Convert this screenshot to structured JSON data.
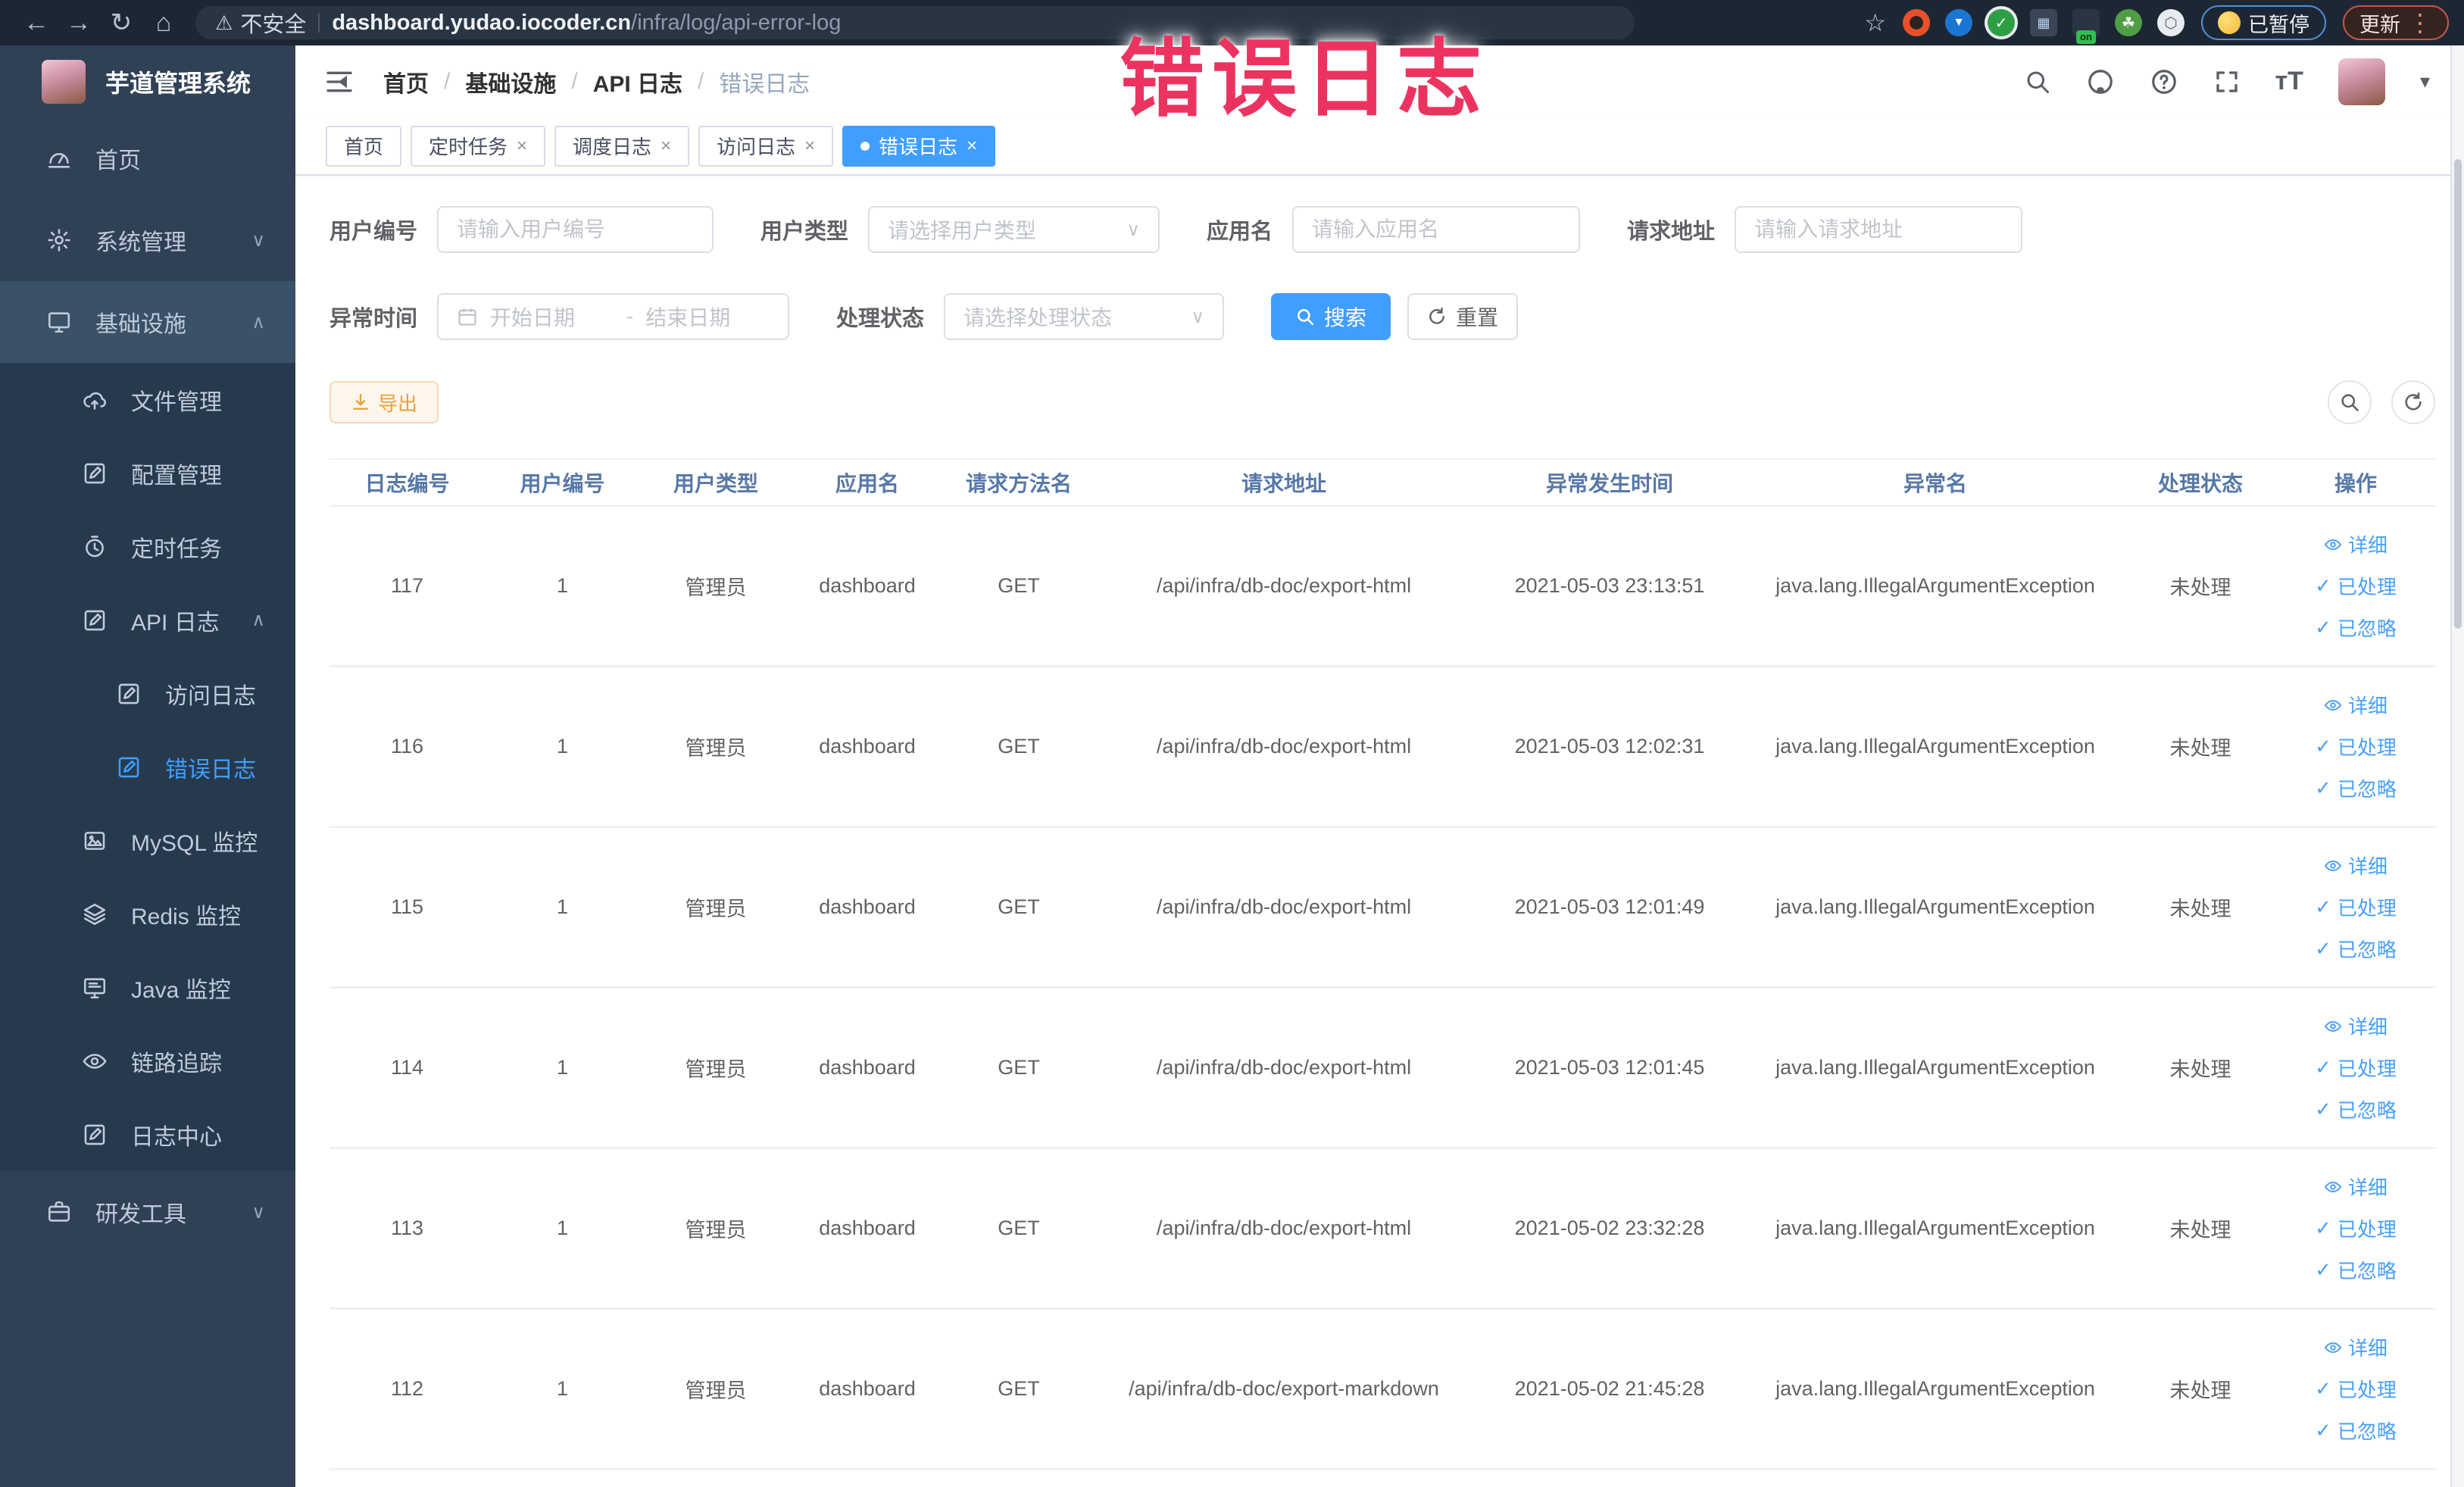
{
  "browser": {
    "security_label": "不安全",
    "url_host": "dashboard.yudao.iocoder.cn",
    "url_path": "/infra/log/api-error-log",
    "paused_label": "已暂停",
    "update_label": "更新",
    "extensions": [
      {
        "icon": "orange-ring-extension-icon",
        "bg": "#e8502a"
      },
      {
        "icon": "blue-shield-extension-icon",
        "bg": "#1976d2"
      },
      {
        "icon": "green-check-extension-icon",
        "bg": "#2e9e44"
      },
      {
        "icon": "grid-extension-icon",
        "bg": "#5c6b7a"
      },
      {
        "icon": "switch-on-extension-icon",
        "bg": "#2b3442",
        "badge": "on"
      },
      {
        "icon": "leaf-extension-icon",
        "bg": "#4f9e43"
      },
      {
        "icon": "puzzle-extension-icon",
        "bg": "#e8ecf1"
      }
    ]
  },
  "annotation": {
    "text": "错误日志",
    "color": "#ec3360"
  },
  "app": {
    "title": "芋道管理系统",
    "breadcrumb": [
      "首页",
      "基础设施",
      "API 日志",
      "错误日志"
    ],
    "tabs": [
      {
        "label": "首页",
        "closable": false,
        "active": false
      },
      {
        "label": "定时任务",
        "closable": true,
        "active": false
      },
      {
        "label": "调度日志",
        "closable": true,
        "active": false
      },
      {
        "label": "访问日志",
        "closable": true,
        "active": false
      },
      {
        "label": "错误日志",
        "closable": true,
        "active": true
      }
    ]
  },
  "sidebar": {
    "items": [
      {
        "label": "首页",
        "icon": "dashboard-icon",
        "level": 1
      },
      {
        "label": "系统管理",
        "icon": "gear-icon",
        "level": 1,
        "chevron": "down"
      },
      {
        "label": "基础设施",
        "icon": "monitor-icon",
        "level": 1,
        "chevron": "up",
        "highlight": true
      },
      {
        "label": "文件管理",
        "icon": "upload-icon",
        "level": 2,
        "submenu": true
      },
      {
        "label": "配置管理",
        "icon": "edit-square-icon",
        "level": 2,
        "submenu": true
      },
      {
        "label": "定时任务",
        "icon": "timer-icon",
        "level": 2,
        "submenu": true
      },
      {
        "label": "API 日志",
        "icon": "edit-square-icon",
        "level": 2,
        "submenu": true,
        "chevron": "up"
      },
      {
        "label": "访问日志",
        "icon": "edit-square-icon",
        "level": 3,
        "submenu": true
      },
      {
        "label": "错误日志",
        "icon": "edit-square-icon",
        "level": 3,
        "submenu": true,
        "active": true
      },
      {
        "label": "MySQL 监控",
        "icon": "mysql-picture-icon",
        "level": 2,
        "submenu": true
      },
      {
        "label": "Redis 监控",
        "icon": "layers-icon",
        "level": 2,
        "submenu": true
      },
      {
        "label": "Java 监控",
        "icon": "java-monitor-icon",
        "level": 2,
        "submenu": true
      },
      {
        "label": "链路追踪",
        "icon": "eye-icon",
        "level": 2,
        "submenu": true
      },
      {
        "label": "日志中心",
        "icon": "edit-square-icon",
        "level": 2,
        "submenu": true
      },
      {
        "label": "研发工具",
        "icon": "briefcase-icon",
        "level": 1,
        "chevron": "down"
      }
    ]
  },
  "filters": {
    "fields_row1": [
      {
        "label": "用户编号",
        "placeholder": "请输入用户编号",
        "type": "input"
      },
      {
        "label": "用户类型",
        "placeholder": "请选择用户类型",
        "type": "select"
      },
      {
        "label": "应用名",
        "placeholder": "请输入应用名",
        "type": "input"
      },
      {
        "label": "请求地址",
        "placeholder": "请输入请求地址",
        "type": "input"
      }
    ],
    "time_label": "异常时间",
    "date_start_placeholder": "开始日期",
    "date_separator": "-",
    "date_end_placeholder": "结束日期",
    "status_label": "处理状态",
    "status_placeholder": "请选择处理状态",
    "search_label": "搜索",
    "reset_label": "重置"
  },
  "toolbar": {
    "export_label": "导出"
  },
  "table": {
    "columns": [
      "日志编号",
      "用户编号",
      "用户类型",
      "应用名",
      "请求方法名",
      "请求地址",
      "异常发生时间",
      "异常名",
      "处理状态",
      "操作"
    ],
    "rows": [
      {
        "id": "117",
        "user_id": "1",
        "user_type": "管理员",
        "app_name": "dashboard",
        "method": "GET",
        "url": "/api/infra/db-doc/export-html",
        "time": "2021-05-03 23:13:51",
        "exception": "java.lang.IllegalArgumentException",
        "status": "未处理"
      },
      {
        "id": "116",
        "user_id": "1",
        "user_type": "管理员",
        "app_name": "dashboard",
        "method": "GET",
        "url": "/api/infra/db-doc/export-html",
        "time": "2021-05-03 12:02:31",
        "exception": "java.lang.IllegalArgumentException",
        "status": "未处理"
      },
      {
        "id": "115",
        "user_id": "1",
        "user_type": "管理员",
        "app_name": "dashboard",
        "method": "GET",
        "url": "/api/infra/db-doc/export-html",
        "time": "2021-05-03 12:01:49",
        "exception": "java.lang.IllegalArgumentException",
        "status": "未处理"
      },
      {
        "id": "114",
        "user_id": "1",
        "user_type": "管理员",
        "app_name": "dashboard",
        "method": "GET",
        "url": "/api/infra/db-doc/export-html",
        "time": "2021-05-03 12:01:45",
        "exception": "java.lang.IllegalArgumentException",
        "status": "未处理"
      },
      {
        "id": "113",
        "user_id": "1",
        "user_type": "管理员",
        "app_name": "dashboard",
        "method": "GET",
        "url": "/api/infra/db-doc/export-html",
        "time": "2021-05-02 23:32:28",
        "exception": "java.lang.IllegalArgumentException",
        "status": "未处理"
      },
      {
        "id": "112",
        "user_id": "1",
        "user_type": "管理员",
        "app_name": "dashboard",
        "method": "GET",
        "url": "/api/infra/db-doc/export-markdown",
        "time": "2021-05-02 21:45:28",
        "exception": "java.lang.IllegalArgumentException",
        "status": "未处理"
      }
    ],
    "row_actions": [
      {
        "label": "详细",
        "icon": "eye-icon"
      },
      {
        "label": "已处理",
        "icon": "check-icon"
      },
      {
        "label": "已忽略",
        "icon": "check-icon"
      }
    ]
  },
  "colors": {
    "accent": "#409eff",
    "sidebar_bg": "#304156",
    "submenu_bg": "#273a4d",
    "warning": "#e6a23c",
    "annotation_pink": "#ec3360"
  }
}
